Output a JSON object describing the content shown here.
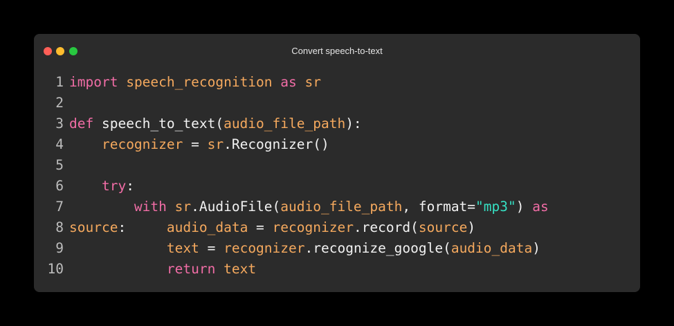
{
  "window": {
    "title": "Convert speech-to-text"
  },
  "colors": {
    "keyword": "#f16da6",
    "identifier": "#f5a95e",
    "plain": "#f2f2f2",
    "string": "#36e0c3",
    "line_number": "#bdbdbd"
  },
  "lines": [
    {
      "number": "1",
      "tokens": [
        {
          "text": "import",
          "type": "kw"
        },
        {
          "text": " ",
          "type": "plain"
        },
        {
          "text": "speech_recognition",
          "type": "var"
        },
        {
          "text": " ",
          "type": "plain"
        },
        {
          "text": "as",
          "type": "kw"
        },
        {
          "text": " ",
          "type": "plain"
        },
        {
          "text": "sr",
          "type": "var"
        }
      ]
    },
    {
      "number": "2",
      "tokens": []
    },
    {
      "number": "3",
      "tokens": [
        {
          "text": "def",
          "type": "kw"
        },
        {
          "text": " speech_to_text(",
          "type": "plain"
        },
        {
          "text": "audio_file_path",
          "type": "var"
        },
        {
          "text": "):",
          "type": "plain"
        }
      ]
    },
    {
      "number": "4",
      "tokens": [
        {
          "text": "    ",
          "type": "plain"
        },
        {
          "text": "recognizer",
          "type": "var"
        },
        {
          "text": " = ",
          "type": "plain"
        },
        {
          "text": "sr",
          "type": "var"
        },
        {
          "text": ".Recognizer()",
          "type": "plain"
        }
      ]
    },
    {
      "number": "5",
      "tokens": []
    },
    {
      "number": "6",
      "tokens": [
        {
          "text": "    ",
          "type": "plain"
        },
        {
          "text": "try",
          "type": "kw"
        },
        {
          "text": ":",
          "type": "plain"
        }
      ]
    },
    {
      "number": "7",
      "tokens": [
        {
          "text": "        ",
          "type": "plain"
        },
        {
          "text": "with",
          "type": "kw"
        },
        {
          "text": " ",
          "type": "plain"
        },
        {
          "text": "sr",
          "type": "var"
        },
        {
          "text": ".AudioFile(",
          "type": "plain"
        },
        {
          "text": "audio_file_path",
          "type": "var"
        },
        {
          "text": ", format=",
          "type": "plain"
        },
        {
          "text": "\"mp3\"",
          "type": "str"
        },
        {
          "text": ") ",
          "type": "plain"
        },
        {
          "text": "as",
          "type": "kw"
        }
      ]
    },
    {
      "number": "8",
      "tokens": [
        {
          "text": "source",
          "type": "var"
        },
        {
          "text": ":     ",
          "type": "plain"
        },
        {
          "text": "audio_data",
          "type": "var"
        },
        {
          "text": " = ",
          "type": "plain"
        },
        {
          "text": "recognizer",
          "type": "var"
        },
        {
          "text": ".record(",
          "type": "plain"
        },
        {
          "text": "source",
          "type": "var"
        },
        {
          "text": ")",
          "type": "plain"
        }
      ]
    },
    {
      "number": "9",
      "tokens": [
        {
          "text": "            ",
          "type": "plain"
        },
        {
          "text": "text",
          "type": "var"
        },
        {
          "text": " = ",
          "type": "plain"
        },
        {
          "text": "recognizer",
          "type": "var"
        },
        {
          "text": ".recognize_google(",
          "type": "plain"
        },
        {
          "text": "audio_data",
          "type": "var"
        },
        {
          "text": ")",
          "type": "plain"
        }
      ]
    },
    {
      "number": "10",
      "tokens": [
        {
          "text": "            ",
          "type": "plain"
        },
        {
          "text": "return",
          "type": "kw"
        },
        {
          "text": " ",
          "type": "plain"
        },
        {
          "text": "text",
          "type": "var"
        }
      ]
    }
  ]
}
